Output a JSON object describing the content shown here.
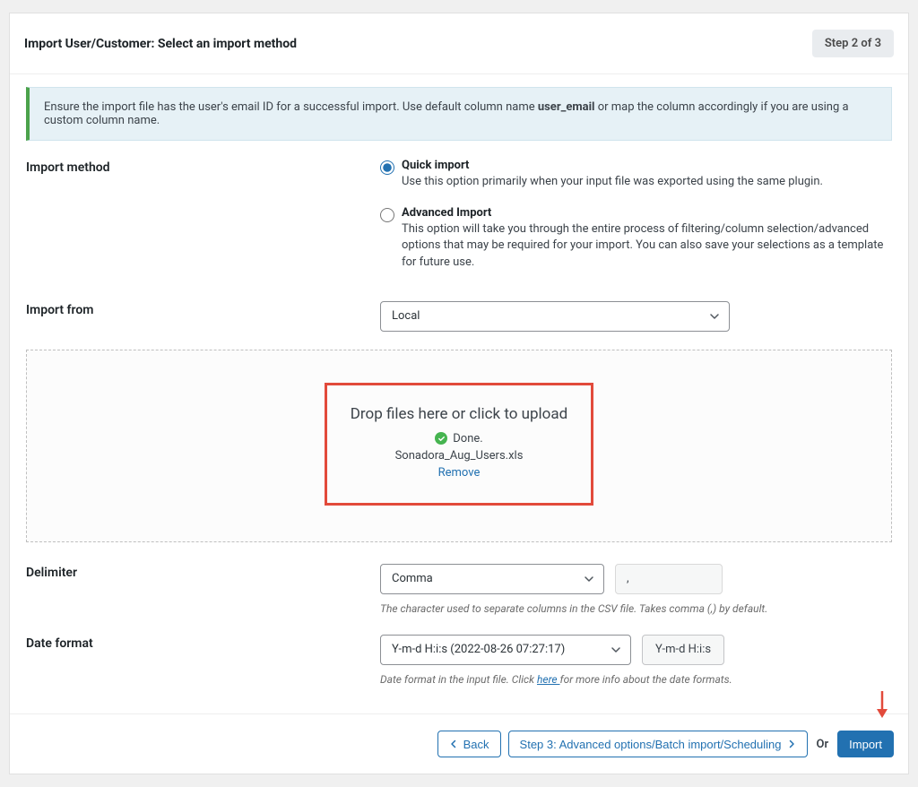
{
  "header": {
    "title": "Import User/Customer: Select an import method",
    "step_label": "Step 2 of 3"
  },
  "notice": {
    "text_before": "Ensure the import file has the user's email ID for a successful import. Use default column name ",
    "bold": "user_email",
    "text_after": " or map the column accordingly if you are using a custom column name."
  },
  "import_method": {
    "label": "Import method",
    "options": {
      "quick": {
        "title": "Quick import",
        "desc": "Use this option primarily when your input file was exported using the same plugin.",
        "checked": true
      },
      "advanced": {
        "title": "Advanced Import",
        "desc": "This option will take you through the entire process of filtering/column selection/advanced options that may be required for your import. You can also save your selections as a template for future use.",
        "checked": false
      }
    }
  },
  "import_from": {
    "label": "Import from",
    "value": "Local"
  },
  "dropzone": {
    "title": "Drop files here or click to upload",
    "done": "Done.",
    "filename": "Sonadora_Aug_Users.xls",
    "remove": "Remove"
  },
  "delimiter": {
    "label": "Delimiter",
    "value": "Comma",
    "char": ",",
    "help": "The character used to separate columns in the CSV file. Takes comma (,) by default."
  },
  "date_format": {
    "label": "Date format",
    "value": "Y-m-d H:i:s (2022-08-26 07:27:17)",
    "sample": "Y-m-d H:i:s",
    "help_before": "Date format in the input file. Click ",
    "help_link": "here ",
    "help_after": "for more info about the date formats."
  },
  "footer": {
    "back": "Back",
    "step3": "Step 3: Advanced options/Batch import/Scheduling",
    "or": "Or",
    "import": "Import"
  }
}
